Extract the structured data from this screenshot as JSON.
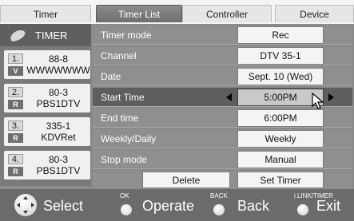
{
  "tabs": [
    {
      "label": "Timer",
      "active": false
    },
    {
      "label": "Timer List",
      "active": true
    },
    {
      "label": "Controller",
      "active": false
    },
    {
      "label": "Device",
      "active": false
    }
  ],
  "sidebar": {
    "header": "TIMER",
    "header_icon": "leaf-icon",
    "items": [
      {
        "num": "1.",
        "tag": "V",
        "line1": "88-8",
        "line2": "WWWWWWW"
      },
      {
        "num": "2.",
        "tag": "R",
        "line1": "80-3",
        "line2": "PBS1DTV"
      },
      {
        "num": "3.",
        "tag": "R",
        "line1": "335-1",
        "line2": "KDVRet"
      },
      {
        "num": "4.",
        "tag": "R",
        "line1": "80-3",
        "line2": "PBS1DTV"
      }
    ]
  },
  "settings": [
    {
      "label": "Timer mode",
      "value": "Rec"
    },
    {
      "label": "Channel",
      "value": "DTV 35-1"
    },
    {
      "label": "Date",
      "value": "Sept. 10 (Wed)"
    },
    {
      "label": "Start Time",
      "value": "5:00PM",
      "selected": true
    },
    {
      "label": "End time",
      "value": "6:00PM"
    },
    {
      "label": "Weekly/Daily",
      "value": "Weekly"
    },
    {
      "label": "Stop mode",
      "value": "Manual"
    }
  ],
  "buttons": {
    "delete": "Delete",
    "set_timer": "Set Timer"
  },
  "footer": {
    "select": {
      "label": "Select",
      "icon": "dpad-icon"
    },
    "operate": {
      "caption": "OK",
      "label": "Operate"
    },
    "back": {
      "caption": "BACK",
      "label": "Back"
    },
    "exit": {
      "caption": "i.LINK/TIMER",
      "label": "Exit"
    }
  },
  "colors": {
    "highlight": "#5e5e5e",
    "panel": "#8f8f8f",
    "footer": "#6b6b6b"
  }
}
